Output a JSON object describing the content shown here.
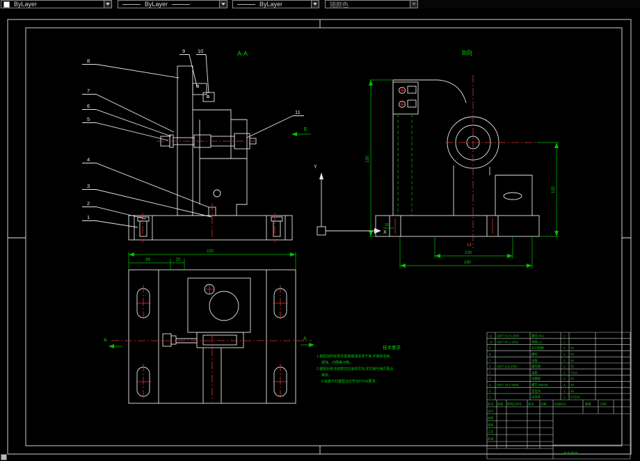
{
  "toolbar": {
    "color": "ByLayer",
    "linetype": "ByLayer",
    "lineweight": "ByLayer",
    "plotstyle": "随颜色"
  },
  "labels": {
    "section": "A-A",
    "view_b": "B向",
    "arrow_e": "E",
    "axis_y": "Y",
    "axis_x": "X",
    "sec_a_left": "A",
    "sec_a_right": "A"
  },
  "callouts": [
    "1",
    "2",
    "3",
    "4",
    "5",
    "6",
    "7",
    "8",
    "9",
    "10",
    "11"
  ],
  "dims": {
    "plan_width": "220",
    "plan_left": "60",
    "plan_mid": "20",
    "b_height": "150",
    "b_right": "152",
    "b_inner": "100",
    "b_outer": "190",
    "b_small": "10",
    "red_mark": "14"
  },
  "tech": {
    "title": "技术要求",
    "lines": [
      "1.装配前所有零件需用煤油清洗干净,不得有毛刺、",
      "锈蚀、切屑等污物。",
      "2.装配后各活动部位应运动灵活,定位销与销孔配合",
      "良好。",
      "3.钻套与衬套配合应符合H7/n6要求。"
    ]
  },
  "bom": {
    "rows": [
      {
        "seq": "11",
        "code": "GB/T 6170-2000",
        "name": "螺母 M12",
        "qty": "1",
        "mat": ""
      },
      {
        "seq": "10",
        "code": "GB/T 97.1-2002",
        "name": "垫圈 12",
        "qty": "1",
        "mat": ""
      },
      {
        "seq": "9",
        "code": "",
        "name": "开口垫圈",
        "qty": "1",
        "mat": "45"
      },
      {
        "seq": "8",
        "code": "",
        "name": "螺杆",
        "qty": "1",
        "mat": "45"
      },
      {
        "seq": "7",
        "code": "",
        "name": "压板",
        "qty": "1",
        "mat": "45"
      },
      {
        "seq": "6",
        "code": "GB/T 119-2000",
        "name": "圆柱销",
        "qty": "2",
        "mat": "35"
      },
      {
        "seq": "5",
        "code": "",
        "name": "钻套",
        "qty": "1",
        "mat": "T10A"
      },
      {
        "seq": "4",
        "code": "",
        "name": "钻模板",
        "qty": "1",
        "mat": "45"
      },
      {
        "seq": "3",
        "code": "GB/T 70.1-2008",
        "name": "螺钉 M8×25",
        "qty": "4",
        "mat": "35"
      },
      {
        "seq": "2",
        "code": "",
        "name": "定位块",
        "qty": "1",
        "mat": "45"
      },
      {
        "seq": "1",
        "code": "",
        "name": "夹具体",
        "qty": "1",
        "mat": "HT200"
      }
    ]
  },
  "titleblock": {
    "mark": "标记",
    "count": "处数",
    "doc": "更改文件号",
    "sign": "签名",
    "date": "日期",
    "design": "设计",
    "check": "校核",
    "review": "审核",
    "process": "工艺",
    "approve": "批准",
    "stage": "阶段标记",
    "weight": "重量",
    "scale": "比例",
    "sheets": "共 张 第 张"
  },
  "colors": {
    "outline": "#e8e8e8",
    "dimension": "#00cc00",
    "centerline": "#e03434"
  }
}
